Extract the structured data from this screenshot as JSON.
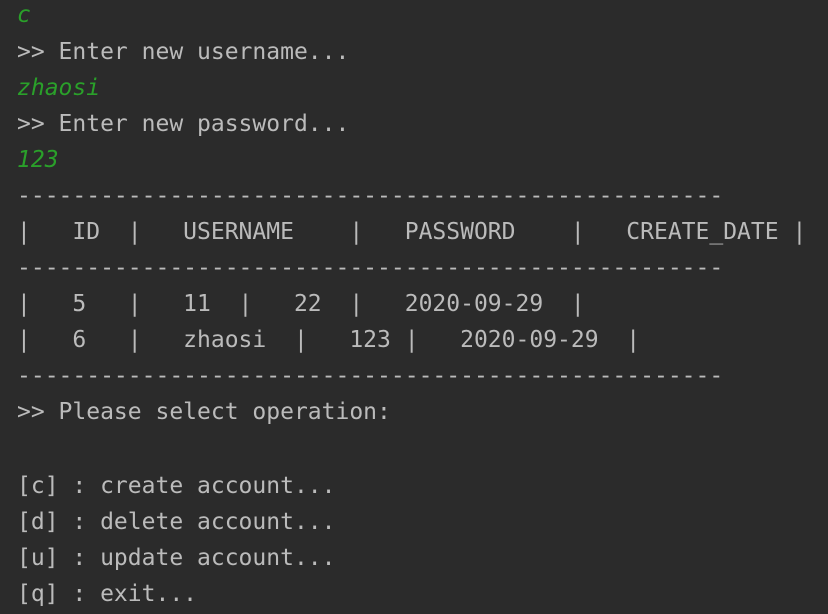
{
  "colors": {
    "background": "#2b2b2b",
    "text": "#bbbbbb",
    "user_input": "#2aa02a"
  },
  "console": {
    "input_choice": "c",
    "prompt_username": ">> Enter new username...",
    "input_username": "zhaosi",
    "prompt_password": ">> Enter new password...",
    "input_password": "123",
    "separator": "---------------------------------------------------",
    "table_header": "|   ID  |   USERNAME    |   PASSWORD    |   CREATE_DATE |",
    "table_rows": [
      "|   5   |   11  |   22  |   2020-09-29  |",
      "|   6   |   zhaosi  |   123 |   2020-09-29  |"
    ],
    "prompt_operation": ">> Please select operation:",
    "menu": [
      "[c] : create account...",
      "[d] : delete account...",
      "[u] : update account...",
      "[q] : exit..."
    ]
  }
}
